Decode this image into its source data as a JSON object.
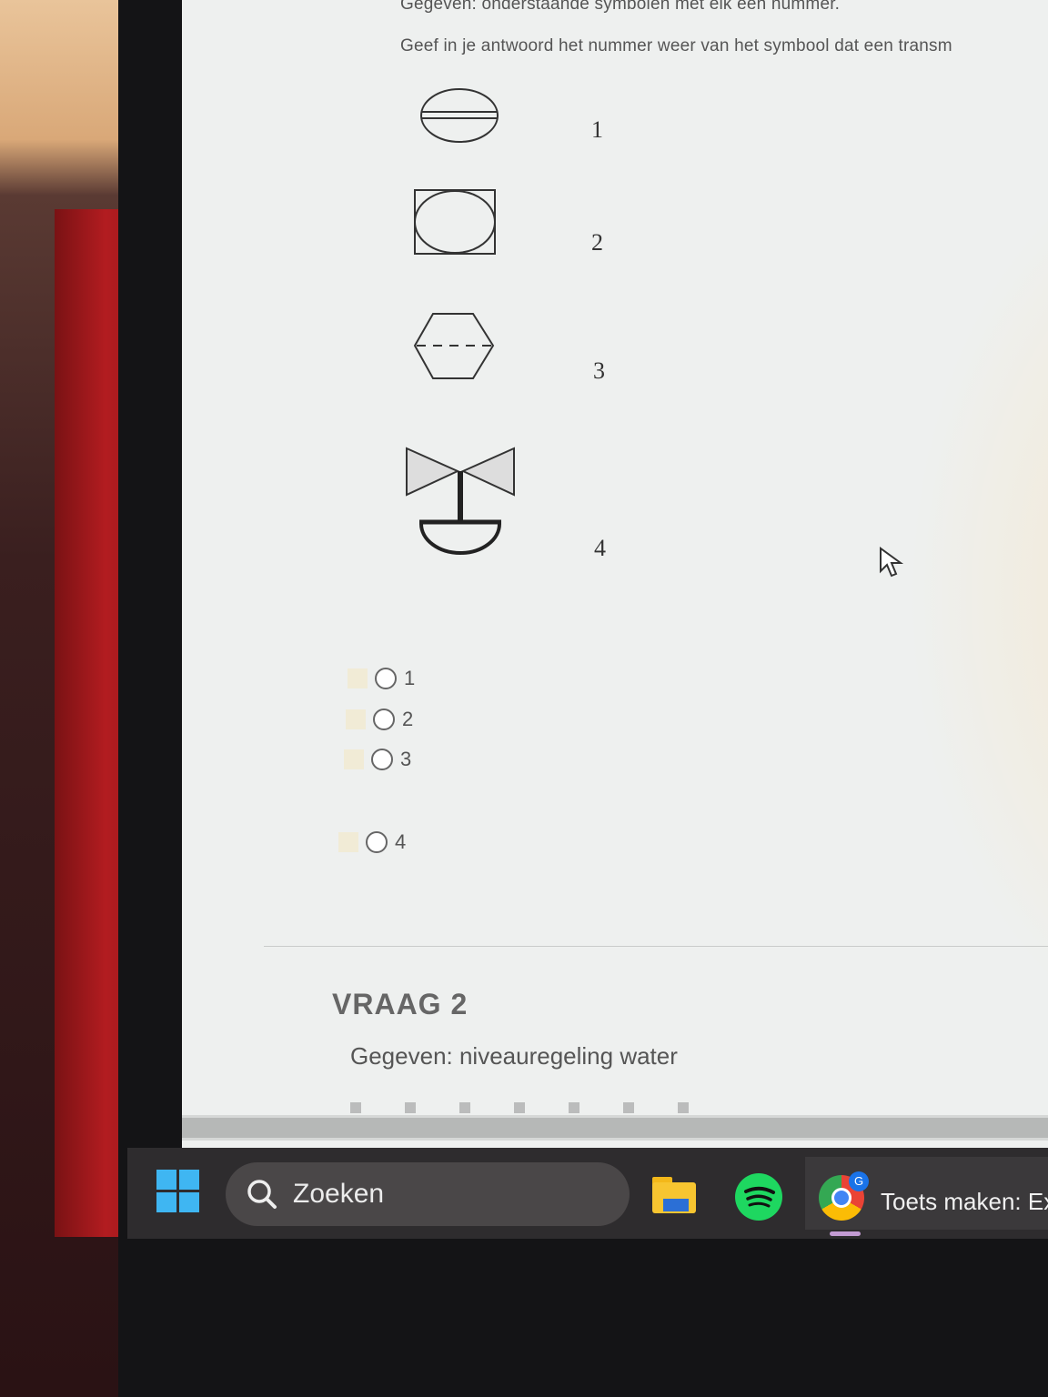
{
  "question1": {
    "intro_line1": "Gegeven: onderstaande symbolen met elk een nummer.",
    "intro_line2": "Geef in je antwoord het nummer weer van het symbool dat een transm",
    "symbols": [
      {
        "number": "1",
        "icon": "circle-with-double-line-icon"
      },
      {
        "number": "2",
        "icon": "circle-in-square-icon"
      },
      {
        "number": "3",
        "icon": "hexagon-dashed-line-icon"
      },
      {
        "number": "4",
        "icon": "diaphragm-valve-icon"
      }
    ],
    "options": [
      "1",
      "2",
      "3",
      "4"
    ]
  },
  "question2": {
    "title": "VRAAG 2",
    "text": "Gegeven: niveauregeling water"
  },
  "taskbar": {
    "search_label": "Zoeken",
    "chrome_badge": "G",
    "chrome_window_title": "Toets maken: Ex"
  },
  "colors": {
    "page_bg": "#eef0ef",
    "taskbar_bg": "#2e2c2e",
    "accent_blue": "#3fb6f2",
    "spotify_green": "#1ed760"
  }
}
